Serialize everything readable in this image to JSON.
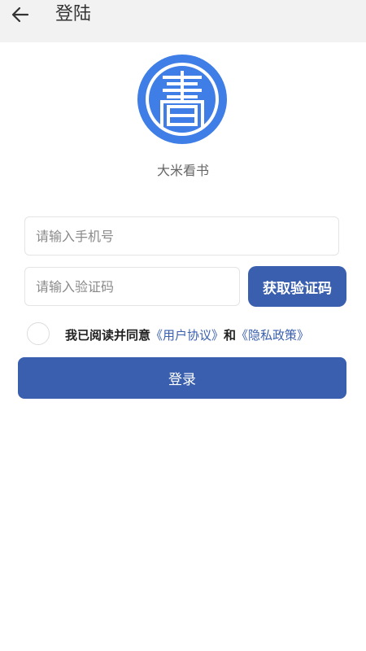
{
  "header": {
    "back_icon": "arrow-left-icon",
    "title": "登陆"
  },
  "logo": {
    "icon": "book-seal-icon",
    "app_name": "大米看书",
    "color": "#3f7ee6"
  },
  "form": {
    "phone_placeholder": "请输入手机号",
    "phone_value": "",
    "code_placeholder": "请输入验证码",
    "code_value": "",
    "get_code_label": "获取验证码"
  },
  "agreement": {
    "checked": false,
    "text": "我已阅读并同意",
    "user_agreement": "《用户协议》",
    "and": "和",
    "privacy_policy": "《隐私政策》"
  },
  "login_button": {
    "label": "登录"
  },
  "colors": {
    "accent": "#3a5fae",
    "header_bg": "#f2f2f2"
  }
}
